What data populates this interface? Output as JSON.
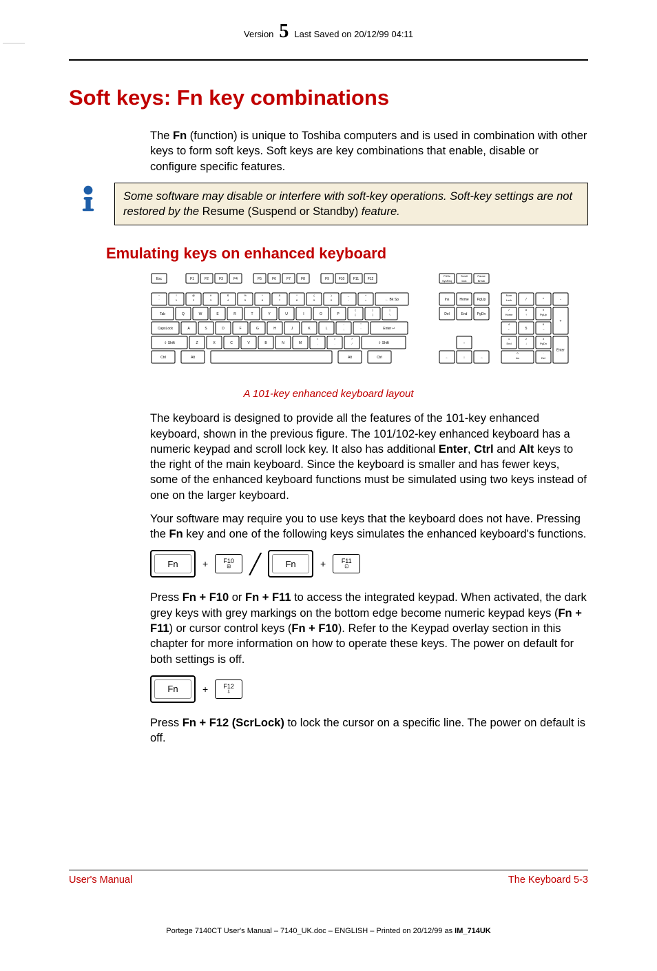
{
  "header": {
    "version_label": "Version",
    "version_num": "5",
    "saved": "Last Saved on 20/12/99 04:11"
  },
  "h1": "Soft keys: Fn key combinations",
  "intro": {
    "pre": "The ",
    "bold1": "Fn",
    "post": " (function) is unique to Toshiba computers and is used in combination with other keys to form soft keys. Soft keys are key combinations that enable, disable or configure specific features."
  },
  "note": {
    "it1": "Some software may disable or interfere with soft-key operations. Soft-key settings are not restored by the ",
    "plain": "Resume (Suspend or Standby)",
    "it2": " feature."
  },
  "h2": "Emulating keys on enhanced keyboard",
  "figcap": "A 101-key enhanced keyboard layout",
  "p1": {
    "t1": "The keyboard is designed to provide all the features of the 101-key enhanced keyboard, shown in the previous figure. The 101/102-key enhanced keyboard has a numeric keypad and scroll lock key. It also has additional ",
    "b1": "Enter",
    "c1": ", ",
    "b2": "Ctrl",
    "c2": " and ",
    "b3": "Alt",
    "t2": " keys to the right of the main keyboard. Since the keyboard is smaller and has fewer keys, some of the enhanced keyboard functions must be simulated using two keys instead of one on the larger keyboard."
  },
  "p2": {
    "t1": "Your software may require you to use keys that the keyboard does not have. Pressing the ",
    "b1": "Fn",
    "t2": " key and one of the following keys simulates the enhanced keyboard's functions."
  },
  "kc1": {
    "fn": "Fn",
    "plus": "+",
    "f10": "F10",
    "f11": "F11"
  },
  "p3": {
    "t1": "Press ",
    "b1": "Fn + F10",
    "t2": " or ",
    "b2": "Fn + F11",
    "t3": " to access the integrated keypad. When activated, the dark grey keys with grey markings on the bottom edge become numeric keypad keys (",
    "b3": "Fn + F11",
    "t4": ") or cursor control keys (",
    "b4": "Fn + F10",
    "t5": "). Refer to the Keypad overlay section in this chapter for more information on how to operate these keys. The power on default for both settings is off."
  },
  "kc2": {
    "fn": "Fn",
    "plus": "+",
    "f12": "F12"
  },
  "p4": {
    "t1": "Press ",
    "b1": "Fn + F12 (ScrLock)",
    "t2": " to lock the cursor on a specific line. The power on default is off."
  },
  "footer": {
    "left": "User's Manual",
    "right": "The Keyboard  5-3"
  },
  "footprint": {
    "t1": "Portege 7140CT User's Manual  – 7140_UK.doc – ENGLISH – Printed on 20/12/99 as ",
    "b1": "IM_714UK"
  },
  "kb": {
    "row_fn": [
      "Esc",
      "F1",
      "F2",
      "F3",
      "F4",
      "F5",
      "F6",
      "F7",
      "F8",
      "F9",
      "F10",
      "F11",
      "F12"
    ],
    "row_num_top": [
      "~",
      "!",
      "@",
      "#",
      "$",
      "%",
      "^",
      "&",
      "*",
      "(",
      ")",
      "_",
      "+"
    ],
    "row_num_bot": [
      "`",
      "1",
      "2",
      "3",
      "4",
      "5",
      "6",
      "7",
      "8",
      "9",
      "0",
      "-",
      "="
    ],
    "bksp": "Bk Sp",
    "row_q_lead": "Tab",
    "row_q": [
      "Q",
      "W",
      "E",
      "R",
      "T",
      "Y",
      "U",
      "I",
      "O",
      "P"
    ],
    "row_q_tail_top": [
      "{",
      "}",
      "|"
    ],
    "row_q_tail_bot": [
      "[",
      "]",
      "\\"
    ],
    "row_a_lead": "CapsLock",
    "row_a": [
      "A",
      "S",
      "D",
      "F",
      "G",
      "H",
      "J",
      "K",
      "L"
    ],
    "row_a_tail_top": [
      ":",
      "\""
    ],
    "row_a_tail_bot": [
      ";",
      "'"
    ],
    "enter": "Enter",
    "row_z_lead": "Shift",
    "row_z": [
      "Z",
      "X",
      "C",
      "V",
      "B",
      "N",
      "M"
    ],
    "row_z_tail_top": [
      "<",
      ">",
      "?"
    ],
    "row_z_tail_bot": [
      ",",
      ".",
      "/"
    ],
    "row_z_trail": "Shift",
    "row_bot": [
      "Ctrl",
      "Alt",
      "",
      "Alt",
      "Ctrl"
    ],
    "nav_top": [
      "PrtSc SysReq",
      "Scroll lock",
      "Pause Break"
    ],
    "nav_mid": [
      "Ins",
      "Home",
      "PgUp",
      "Del",
      "End",
      "PgDn"
    ],
    "arrows": [
      "↑",
      "←",
      "↓",
      "→"
    ],
    "pad_top": [
      "Num Lock",
      "/",
      "*",
      "-"
    ],
    "pad_789": [
      "7 Home",
      "8 ↑",
      "9 PgUp"
    ],
    "pad_456": [
      "4 ←",
      "5",
      "6 →"
    ],
    "pad_plus": "+",
    "pad_123": [
      "1 End",
      "2 ↓",
      "3 PgDn"
    ],
    "pad_enter": "Enter",
    "pad_0": "0 Ins",
    "pad_del": ". Del"
  }
}
